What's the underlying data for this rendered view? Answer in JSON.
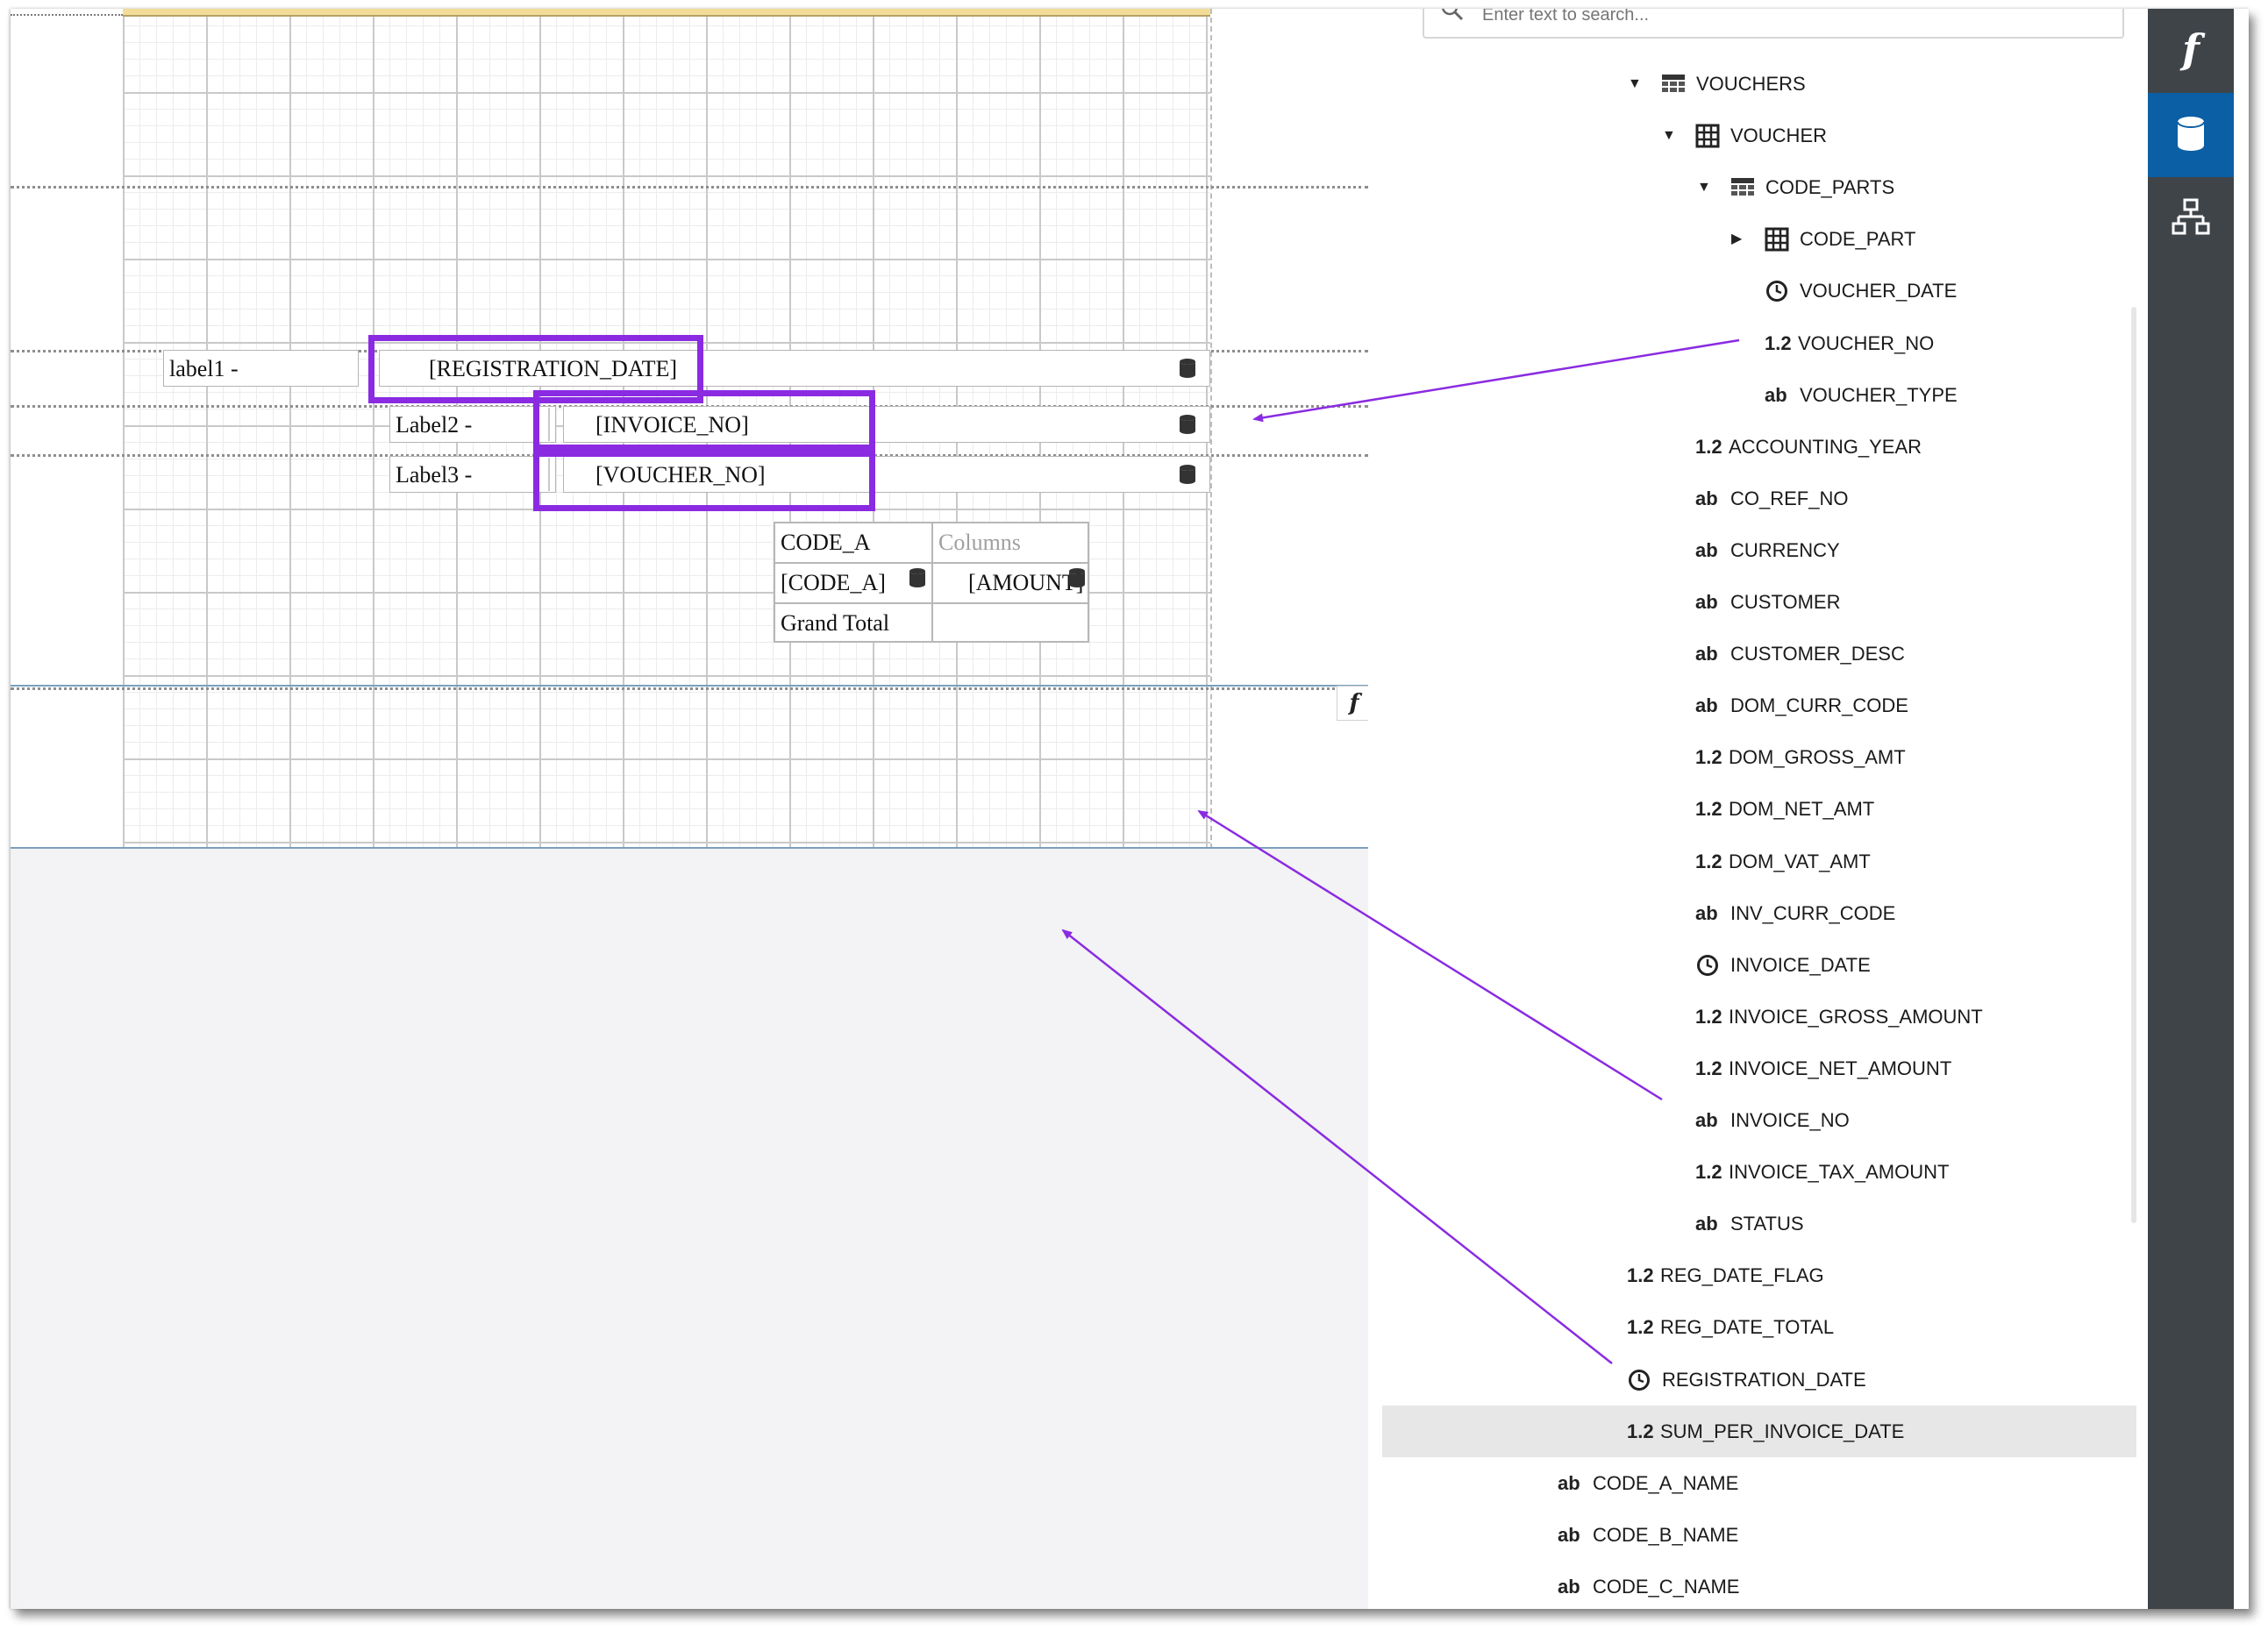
{
  "search": {
    "placeholder": "Enter text to search..."
  },
  "designer": {
    "labels": {
      "label1": "label1 -",
      "label2": "Label2 -",
      "label3": "Label3 -"
    },
    "fields": {
      "registration_date": "[REGISTRATION_DATE]",
      "invoice_no": "[INVOICE_NO]",
      "voucher_no": "[VOUCHER_NO]"
    },
    "crosstab": {
      "row_header": "CODE_A",
      "columns_header": "Columns",
      "row_field": "[CODE_A]",
      "data_field": "[AMOUNT]",
      "grand_total": "Grand Total"
    }
  },
  "field_list": {
    "items": [
      {
        "label": "VOUCHERS",
        "type": "table",
        "expand": "expanded"
      },
      {
        "label": "VOUCHER",
        "type": "grid",
        "expand": "expanded"
      },
      {
        "label": "CODE_PARTS",
        "type": "table",
        "expand": "expanded"
      },
      {
        "label": "CODE_PART",
        "type": "grid",
        "expand": "collapsed"
      },
      {
        "label": "VOUCHER_DATE",
        "type": "date"
      },
      {
        "label": "VOUCHER_NO",
        "type": "number"
      },
      {
        "label": "VOUCHER_TYPE",
        "type": "string"
      },
      {
        "label": "ACCOUNTING_YEAR",
        "type": "number"
      },
      {
        "label": "CO_REF_NO",
        "type": "string"
      },
      {
        "label": "CURRENCY",
        "type": "string"
      },
      {
        "label": "CUSTOMER",
        "type": "string"
      },
      {
        "label": "CUSTOMER_DESC",
        "type": "string"
      },
      {
        "label": "DOM_CURR_CODE",
        "type": "string"
      },
      {
        "label": "DOM_GROSS_AMT",
        "type": "number"
      },
      {
        "label": "DOM_NET_AMT",
        "type": "number"
      },
      {
        "label": "DOM_VAT_AMT",
        "type": "number"
      },
      {
        "label": "INV_CURR_CODE",
        "type": "string"
      },
      {
        "label": "INVOICE_DATE",
        "type": "date"
      },
      {
        "label": "INVOICE_GROSS_AMOUNT",
        "type": "number"
      },
      {
        "label": "INVOICE_NET_AMOUNT",
        "type": "number"
      },
      {
        "label": "INVOICE_NO",
        "type": "string"
      },
      {
        "label": "INVOICE_TAX_AMOUNT",
        "type": "number"
      },
      {
        "label": "STATUS",
        "type": "string"
      },
      {
        "label": "REG_DATE_FLAG",
        "type": "number"
      },
      {
        "label": "REG_DATE_TOTAL",
        "type": "number"
      },
      {
        "label": "REGISTRATION_DATE",
        "type": "date"
      },
      {
        "label": "SUM_PER_INVOICE_DATE",
        "type": "number",
        "selected": true
      },
      {
        "label": "CODE_A_NAME",
        "type": "string"
      },
      {
        "label": "CODE_B_NAME",
        "type": "string"
      },
      {
        "label": "CODE_C_NAME",
        "type": "string"
      }
    ],
    "type_text": {
      "number": "1.2",
      "string": "ab"
    }
  },
  "toolbar": {
    "buttons": [
      {
        "icon": "function-icon",
        "glyph": "f"
      },
      {
        "icon": "database-icon"
      },
      {
        "icon": "hierarchy-icon"
      }
    ]
  },
  "colors": {
    "highlight": "#8a2be2",
    "toolbar_bg": "#3f4449",
    "toolbar_active": "#0b5fa5",
    "selected_row": "#e7e7e7"
  }
}
